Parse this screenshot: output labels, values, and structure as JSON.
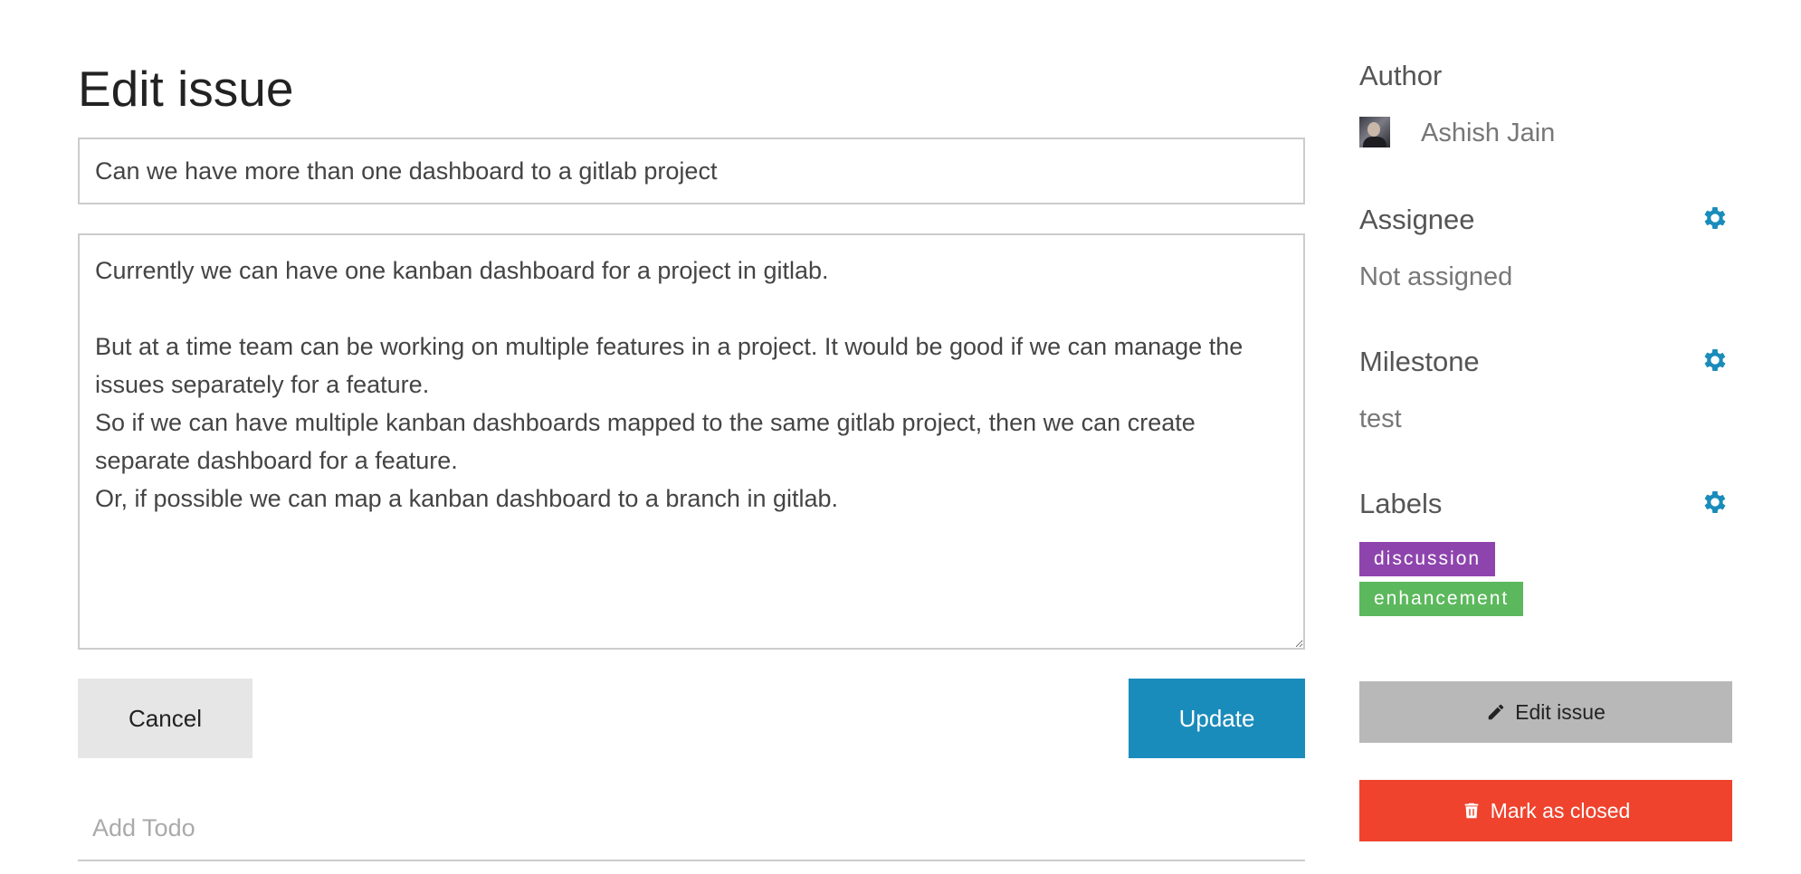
{
  "page": {
    "title": "Edit issue"
  },
  "form": {
    "title_value": "Can we have more than one dashboard to a gitlab project",
    "description_value": "Currently we can have one kanban dashboard for a project in gitlab.\n\nBut at a time team can be working on multiple features in a project. It would be good if we can manage the issues separately for a feature.\nSo if we can have multiple kanban dashboards mapped to the same gitlab project, then we can create separate dashboard for a feature.\nOr, if possible we can map a kanban dashboard to a branch in gitlab.",
    "cancel_label": "Cancel",
    "update_label": "Update",
    "todo_placeholder": "Add Todo"
  },
  "sidebar": {
    "author": {
      "heading": "Author",
      "name": "Ashish Jain"
    },
    "assignee": {
      "heading": "Assignee",
      "value": "Not assigned"
    },
    "milestone": {
      "heading": "Milestone",
      "value": "test"
    },
    "labels": {
      "heading": "Labels",
      "items": [
        {
          "text": "discussion",
          "color": "#8e44ad"
        },
        {
          "text": "enhancement",
          "color": "#5cb85c"
        }
      ]
    },
    "edit_issue_label": "Edit issue",
    "mark_closed_label": "Mark as closed"
  },
  "colors": {
    "accent": "#1a8cbb",
    "danger": "#ef432d",
    "muted_button": "#b8b8b8"
  },
  "icons": {
    "settings": "gear-icon",
    "edit": "pencil-icon",
    "close": "trash-icon"
  }
}
